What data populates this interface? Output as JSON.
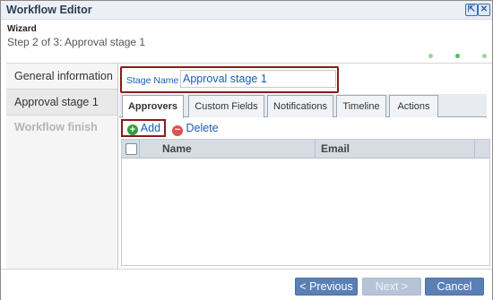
{
  "window": {
    "title": "Workflow Editor",
    "buttons": [
      {
        "icon": "popout-icon",
        "glyph": "⇱"
      },
      {
        "icon": "close-icon",
        "glyph": "✕"
      }
    ]
  },
  "wizard": {
    "label": "Wizard",
    "step_text": "Step 2 of 3: Approval stage 1"
  },
  "steps": [
    {
      "label": "General information",
      "state": "done"
    },
    {
      "label": "Approval stage 1",
      "state": "current"
    },
    {
      "label": "Workflow finish",
      "state": "future"
    }
  ],
  "stage": {
    "label": "Stage Name",
    "value": "Approval stage 1"
  },
  "tabs": [
    "Approvers",
    "Custom Fields",
    "Notifications",
    "Timeline",
    "Actions"
  ],
  "toolbar": {
    "add_icon": "+",
    "add_label": "Add",
    "delete_icon": "−",
    "delete_label": "Delete"
  },
  "grid": {
    "columns": [
      "Name",
      "Email"
    ]
  },
  "footer": {
    "previous_label": "< Previous",
    "next_label": "Next >",
    "cancel_label": "Cancel"
  },
  "colors": {
    "accent": "#5a7fb5",
    "highlight_border": "#8b1a1a",
    "link": "#1b5eb0"
  }
}
